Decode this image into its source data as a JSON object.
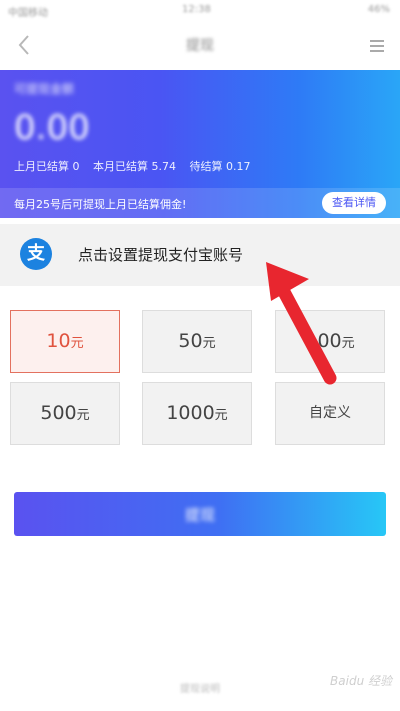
{
  "status_bar": {
    "carrier": "中国移动",
    "time": "12:38",
    "battery": "46%"
  },
  "nav": {
    "title": "提现"
  },
  "balance": {
    "label": "可提现金额",
    "amount": "0.00",
    "settled_last_month": "上月已结算 0",
    "settled_this_month": "本月已结算 5.74",
    "pending": "待结算 0.17",
    "notice": "每月25号后可提现上月已结算佣金!",
    "details_button": "查看详情"
  },
  "alipay": {
    "logo_char": "支",
    "prompt": "点击设置提现支付宝账号"
  },
  "amount_options": [
    {
      "value": "10",
      "unit": "元",
      "selected": true
    },
    {
      "value": "50",
      "unit": "元",
      "selected": false
    },
    {
      "value": "100",
      "unit": "元",
      "selected": false
    },
    {
      "value": "500",
      "unit": "元",
      "selected": false
    },
    {
      "value": "1000",
      "unit": "元",
      "selected": false
    },
    {
      "custom_label": "自定义",
      "selected": false
    }
  ],
  "withdraw_button": {
    "label": "提现"
  },
  "footer": {
    "text": "提现说明"
  },
  "watermark": {
    "text": "Baidu 经验"
  },
  "colors": {
    "accent_purple": "#5a52f0",
    "accent_cyan": "#27c7f6",
    "selected_red": "#e0533f",
    "alipay_blue": "#1c82e0",
    "annotation_red": "#e8262f"
  }
}
